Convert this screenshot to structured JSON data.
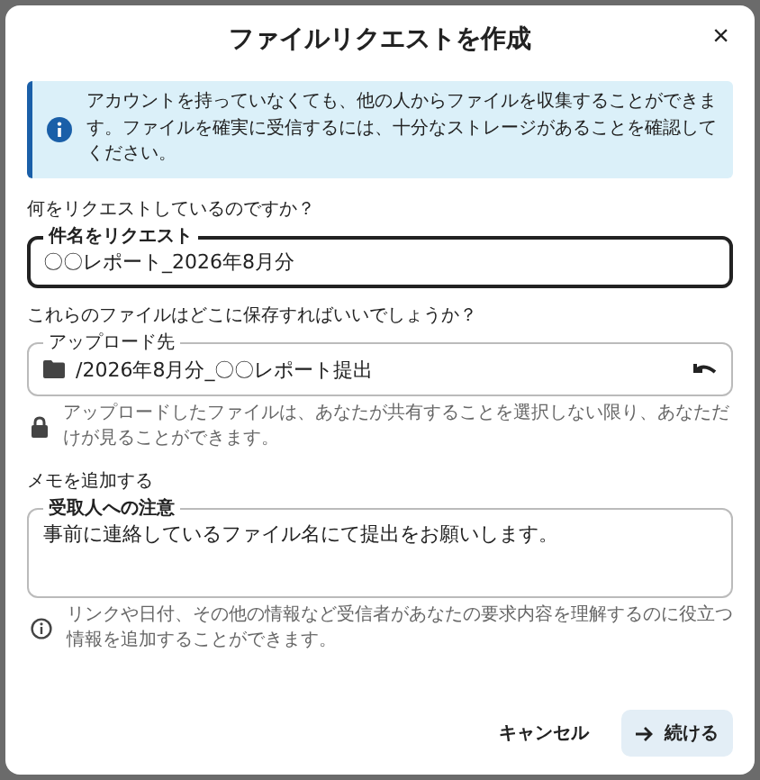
{
  "dialog": {
    "title": "ファイルリクエストを作成",
    "close": "×"
  },
  "info": "アカウントを持っていなくても、他の人からファイルを収集することができます。ファイルを確実に受信するには、十分なストレージがあることを確認してください。",
  "request": {
    "question": "何をリクエストしているのですか？",
    "label": "件名をリクエスト",
    "value": "〇〇レポート_2026年8月分",
    "focused": true
  },
  "destination": {
    "question": "これらのファイルはどこに保存すればいいでしょうか？",
    "label": "アップロード先",
    "value": "/2026年8月分_〇〇レポート提出",
    "note": "アップロードしたファイルは、あなたが共有することを選択しない限り、あなただけが見ることができます。"
  },
  "memo": {
    "question": "メモを追加する",
    "label": "受取人への注意",
    "value": "事前に連絡しているファイル名にて提出をお願いします。",
    "hint": "リンクや日付、その他の情報など受信者があなたの要求内容を理解するのに役立つ情報を追加することができます。"
  },
  "buttons": [
    {
      "label": "キャンセル",
      "kind": "text"
    },
    {
      "label": "続ける",
      "kind": "primary"
    }
  ]
}
